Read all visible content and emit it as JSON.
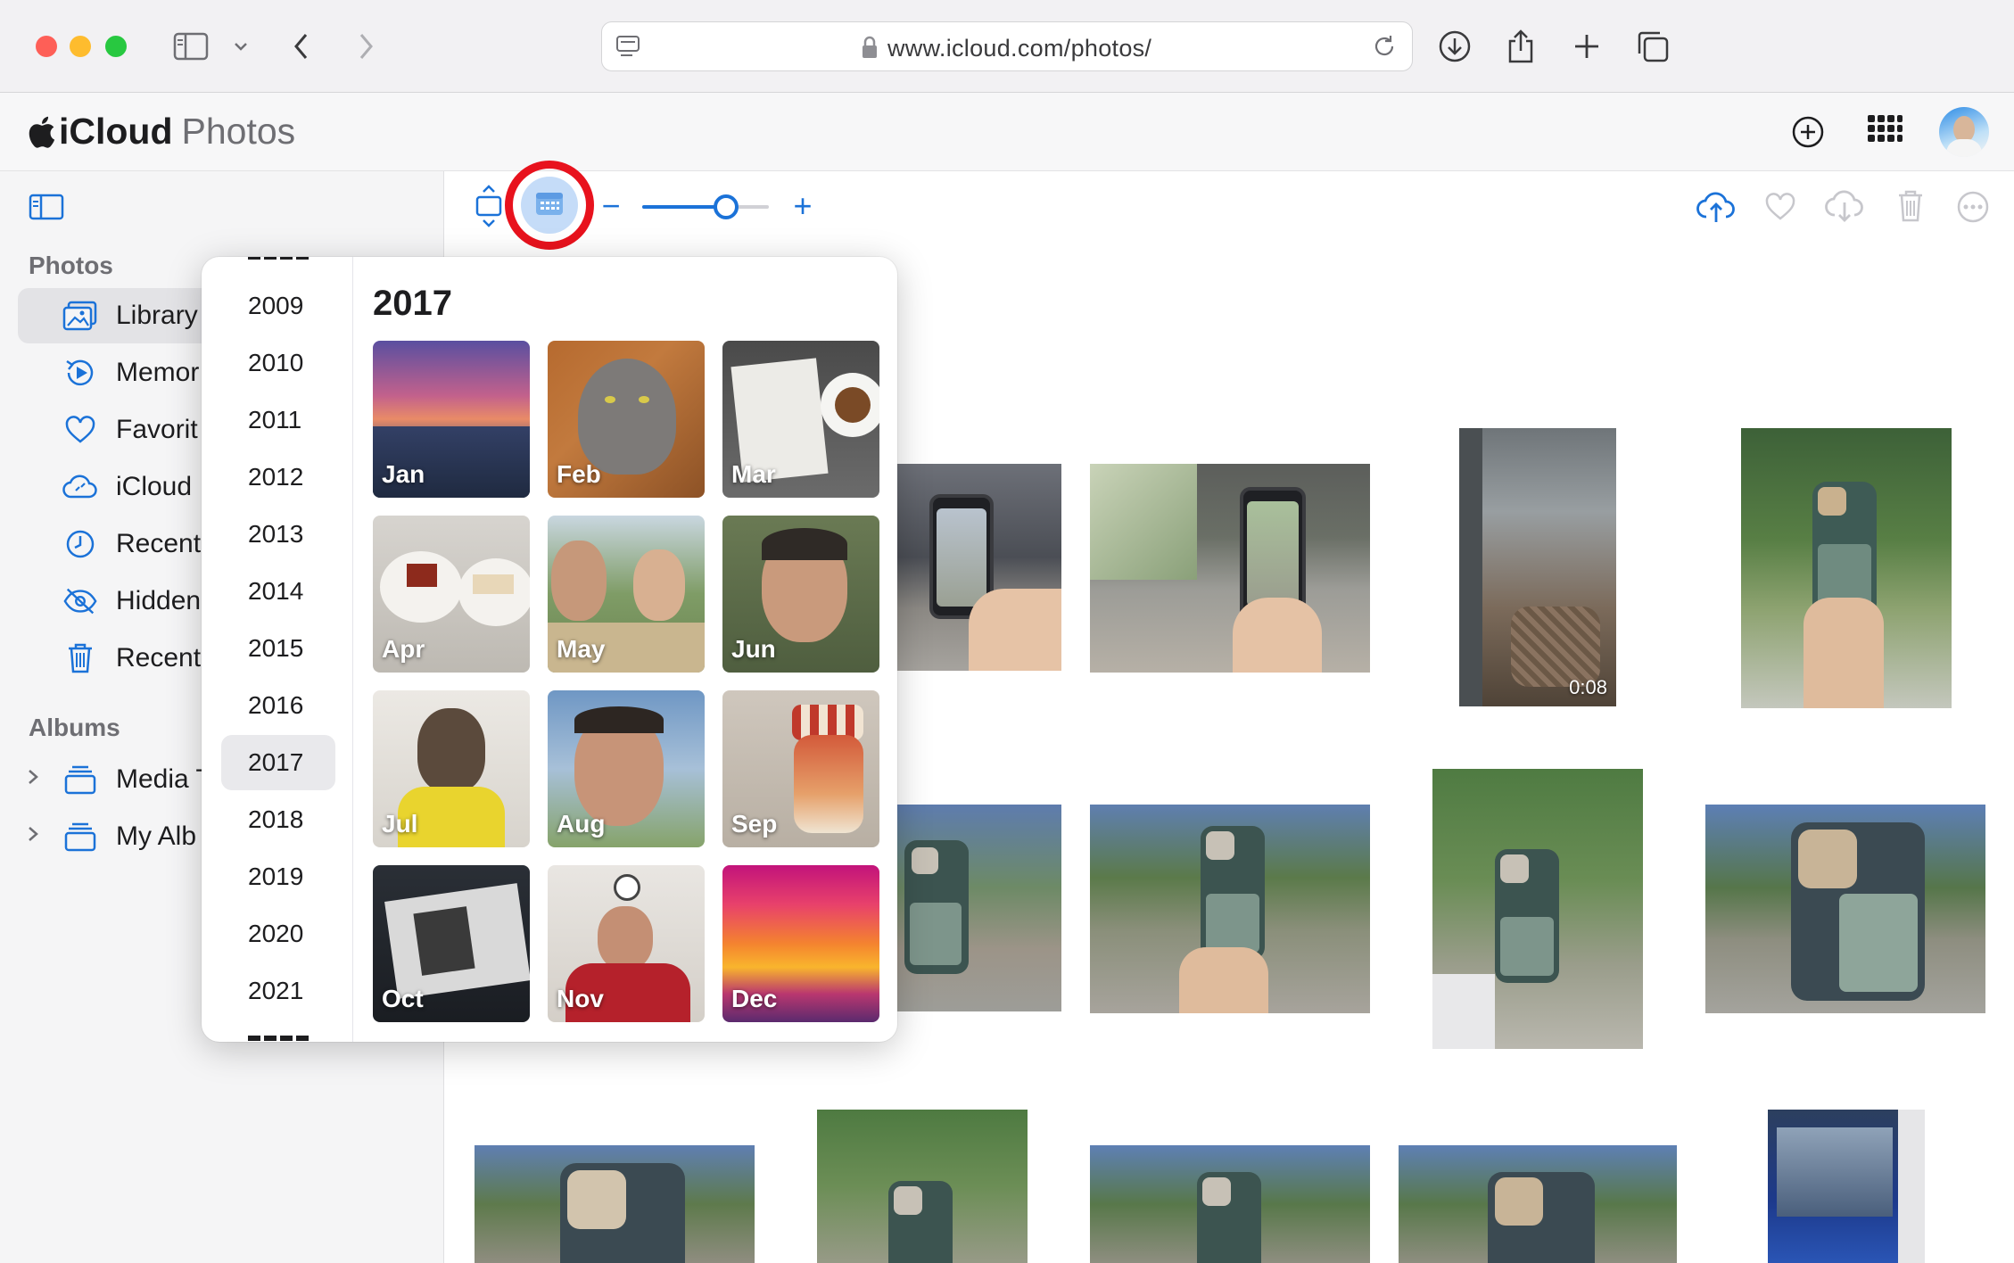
{
  "browser": {
    "url": "www.icloud.com/photos/"
  },
  "app": {
    "title": "iCloud",
    "brand_suffix": "Photos"
  },
  "sidebar": {
    "photos_section": "Photos",
    "items": [
      {
        "label": "Library",
        "icon": "library-icon"
      },
      {
        "label": "Memor",
        "icon": "memories-icon"
      },
      {
        "label": "Favorit",
        "icon": "heart-icon"
      },
      {
        "label": "iCloud",
        "icon": "icloud-link-icon"
      },
      {
        "label": "Recent",
        "icon": "clock-icon"
      },
      {
        "label": "Hidden",
        "icon": "eye-slash-icon"
      },
      {
        "label": "Recent",
        "icon": "trash-icon"
      }
    ],
    "albums_section": "Albums",
    "albums": [
      {
        "label": "Media T",
        "icon": "album-stack-icon"
      },
      {
        "label": "My Alb",
        "icon": "album-stack-icon"
      }
    ]
  },
  "toolbar": {
    "zoom_minus": "−",
    "zoom_plus": "+",
    "zoom_level": 0.66
  },
  "popover": {
    "title": "2017",
    "years": [
      "2009",
      "2010",
      "2011",
      "2012",
      "2013",
      "2014",
      "2015",
      "2016",
      "2017",
      "2018",
      "2019",
      "2020",
      "2021"
    ],
    "selected_year": "2017",
    "months": [
      "Jan",
      "Feb",
      "Mar",
      "Apr",
      "May",
      "Jun",
      "Jul",
      "Aug",
      "Sep",
      "Oct",
      "Nov",
      "Dec"
    ]
  },
  "grid": {
    "video_duration": "0:08"
  },
  "colors": {
    "accent": "#1b72d8",
    "highlight": "#e8121d"
  }
}
